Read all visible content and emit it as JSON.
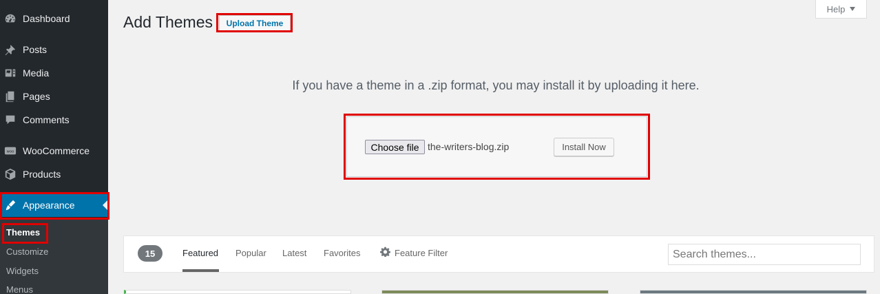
{
  "sidebar": {
    "items": [
      {
        "label": "Dashboard",
        "icon": "dashboard-icon"
      },
      {
        "label": "Posts",
        "icon": "pin-icon"
      },
      {
        "label": "Media",
        "icon": "media-icon"
      },
      {
        "label": "Pages",
        "icon": "pages-icon"
      },
      {
        "label": "Comments",
        "icon": "comment-icon"
      },
      {
        "label": "WooCommerce",
        "icon": "woocommerce-icon"
      },
      {
        "label": "Products",
        "icon": "box-icon"
      },
      {
        "label": "Appearance",
        "icon": "brush-icon"
      }
    ],
    "active_item": "Appearance",
    "submenu": [
      {
        "label": "Themes"
      },
      {
        "label": "Customize"
      },
      {
        "label": "Widgets"
      },
      {
        "label": "Menus"
      }
    ],
    "current_submenu": "Themes"
  },
  "header": {
    "title": "Add Themes",
    "upload_button": "Upload Theme",
    "help_label": "Help"
  },
  "upload": {
    "description": "If you have a theme in a .zip format, you may install it by uploading it here.",
    "choose_file_label": "Choose file",
    "file_name": "the-writers-blog.zip",
    "install_label": "Install Now"
  },
  "filters": {
    "count": "15",
    "tabs": [
      "Featured",
      "Popular",
      "Latest",
      "Favorites"
    ],
    "current_tab": "Featured",
    "feature_filter_label": "Feature Filter",
    "search_placeholder": "Search themes..."
  },
  "colors": {
    "sidebar_bg": "#23282d",
    "active_bg": "#0073aa",
    "highlight": "#e00000",
    "page_bg": "#f1f1f1"
  }
}
